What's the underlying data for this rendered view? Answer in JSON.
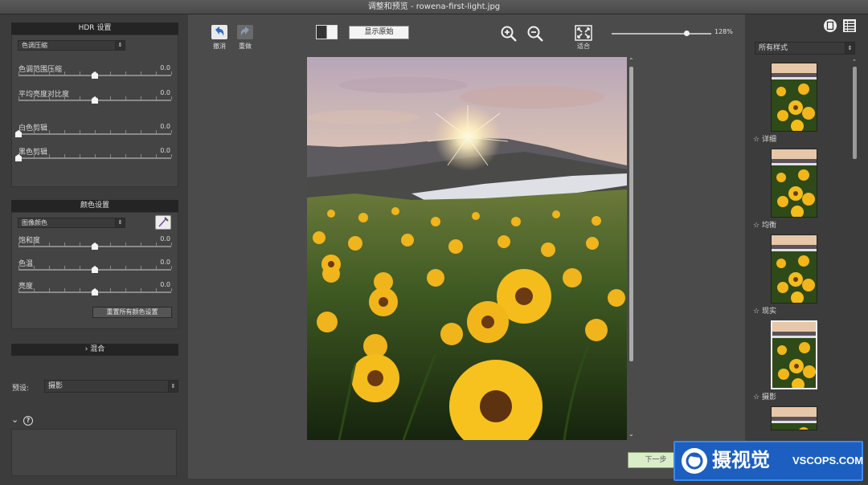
{
  "window": {
    "title": "调整和预览 - rowena-first-light.jpg"
  },
  "hdr": {
    "header": "HDR 设置",
    "mode": "色调压缩",
    "sliders": [
      {
        "label": "色调范围压缩",
        "value": "0.0",
        "pos": 0.5
      },
      {
        "label": "平均亮度对比度",
        "value": "0.0",
        "pos": 0.5
      },
      {
        "label": "白色剪辑",
        "value": "0.0",
        "pos": 0.0
      },
      {
        "label": "黑色剪辑",
        "value": "0.0",
        "pos": 0.0
      }
    ]
  },
  "color": {
    "header": "颜色设置",
    "mode": "图像颜色",
    "sliders": [
      {
        "label": "饱和度",
        "value": "0.0",
        "pos": 0.5
      },
      {
        "label": "色温",
        "value": "0.0",
        "pos": 0.5
      },
      {
        "label": "亮度",
        "value": "0.0",
        "pos": 0.5
      }
    ],
    "reset_label": "重置所有颜色设置"
  },
  "blend": {
    "label": "混合"
  },
  "preset": {
    "label": "预设:",
    "value": "摄影"
  },
  "toolbar": {
    "undo": "撤消",
    "redo": "重做",
    "show_original": "显示原始",
    "fit": "适合",
    "zoom": "128%",
    "zoom_pos": 0.75
  },
  "next": {
    "label": "下一步"
  },
  "styles": {
    "filter": "所有样式",
    "items": [
      {
        "label": "详细",
        "selected": false
      },
      {
        "label": "均衡",
        "selected": false
      },
      {
        "label": "现实",
        "selected": false
      },
      {
        "label": "摄影",
        "selected": true
      }
    ]
  },
  "watermark": {
    "brand": "摄视觉",
    "site": "VSCOPS.COM"
  },
  "colors": {
    "accent_next": "#d9eec8",
    "header_bg": "#242424",
    "watermark_bg": "#1c5fc0"
  }
}
